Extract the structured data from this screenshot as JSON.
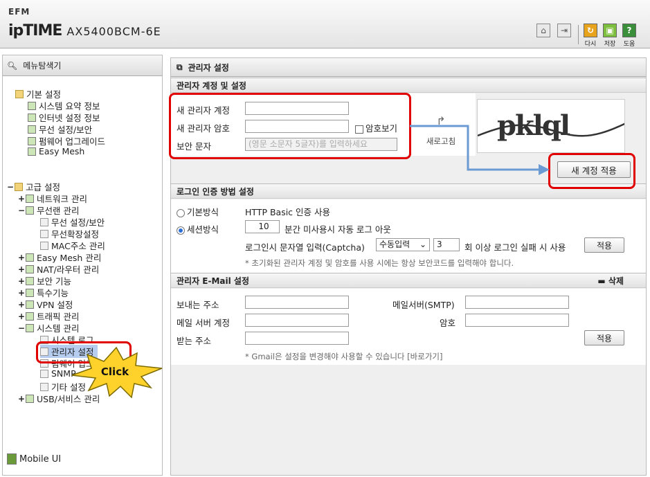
{
  "header": {
    "brand_small": "EFM",
    "brand": "ipTIME",
    "model": "AX5400BCM-6E",
    "actions": [
      {
        "label": "다시",
        "color": "#e8a31c"
      },
      {
        "label": "저장",
        "color": "#7fbf3f"
      },
      {
        "label": "도움",
        "color": "#3b8f3b"
      }
    ]
  },
  "sidebar": {
    "title": "메뉴탐색기",
    "basic": {
      "label": "기본 설정",
      "items": [
        "시스템 요약 정보",
        "인터넷 설정 정보",
        "무선 설정/보안",
        "펌웨어 업그레이드",
        "Easy Mesh"
      ]
    },
    "advanced": {
      "label": "고급 설정",
      "network": "네트워크 관리",
      "wireless": "무선랜 관리",
      "wireless_sub": [
        "무선 설정/보안",
        "무선확장설정",
        "MAC주소 관리"
      ],
      "easymesh": "Easy Mesh 관리",
      "nat": "NAT/라우터 관리",
      "security": "보안 기능",
      "special": "특수기능",
      "vpn": "VPN 설정",
      "traffic": "트래픽 관리",
      "system": "시스템 관리",
      "system_sub": [
        "시스템 로그",
        "관리자 설정",
        "펌웨어 업그",
        "SNMP",
        "기타 설정"
      ],
      "usb": "USB/서비스 관리"
    },
    "mobile": "Mobile UI"
  },
  "callout": "Click",
  "main": {
    "title": "관리자 설정",
    "account": {
      "header": "관리자 계정 및 설정",
      "new_id": "새 관리자 계정",
      "new_pw": "새 관리자 암호",
      "show_pw": "암호보기",
      "captcha": "보안 문자",
      "captcha_placeholder": "(영문 소문자 5글자)를 입력하세요",
      "refresh": "새로고침",
      "captcha_text": "pklql",
      "apply": "새 계정 적용"
    },
    "login": {
      "header": "로그인 인증 방법 설정",
      "basic": "기본방식",
      "basic_desc": "HTTP Basic 인증 사용",
      "session": "세션방식",
      "minutes": "10",
      "minutes_desc": "분간 미사용시 자동 로그 아웃",
      "captcha_label": "로그인시 문자열 입력(Captcha)",
      "captcha_mode": "수동입력",
      "fail_count": "3",
      "fail_desc": "회 이상 로그인 실패 시 사용",
      "apply": "적용",
      "note": "* 초기화된 관리자 계정 및 암호를 사용 시에는 항상 보안코드를 입력해야 합니다."
    },
    "email": {
      "header": "관리자 E-Mail 설정",
      "delete": "삭제",
      "from": "보내는 주소",
      "smtp": "메일서버(SMTP)",
      "account": "메일 서버 계정",
      "password": "암호",
      "to": "받는 주소",
      "apply": "적용",
      "note": "* Gmail은 설정을 변경해야 사용할 수 있습니다 [바로가기]"
    }
  }
}
